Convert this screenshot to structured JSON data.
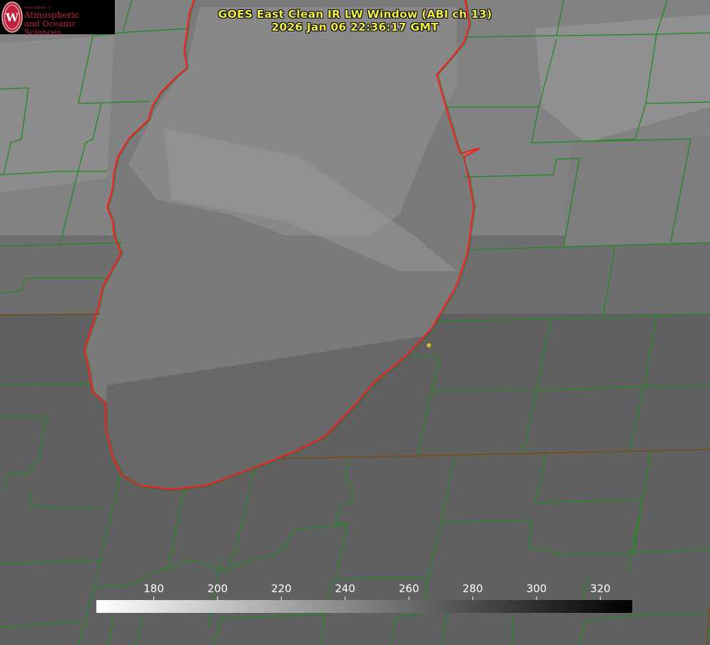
{
  "product": {
    "title": "GOES East Clean IR LW Window (ABI ch 13)",
    "timestamp": "2026 Jan 06 22:36:17 GMT"
  },
  "logo": {
    "department": "Department of",
    "line1": "Atmospheric",
    "line2": "and Oceanic Sciences",
    "emblem": "uw-crest-icon"
  },
  "colorbar": {
    "ticks": [
      "180",
      "200",
      "220",
      "240",
      "260",
      "280",
      "300",
      "320"
    ],
    "tick_values": [
      180,
      200,
      220,
      240,
      260,
      280,
      300,
      320
    ],
    "range": [
      162,
      330
    ],
    "scale": "white-to-black"
  },
  "colors": {
    "boundary": "#1e8a1e",
    "shoreline": "#ff1a1a",
    "title_text": "#f2ee3a",
    "point_marker": "#d8c020"
  }
}
